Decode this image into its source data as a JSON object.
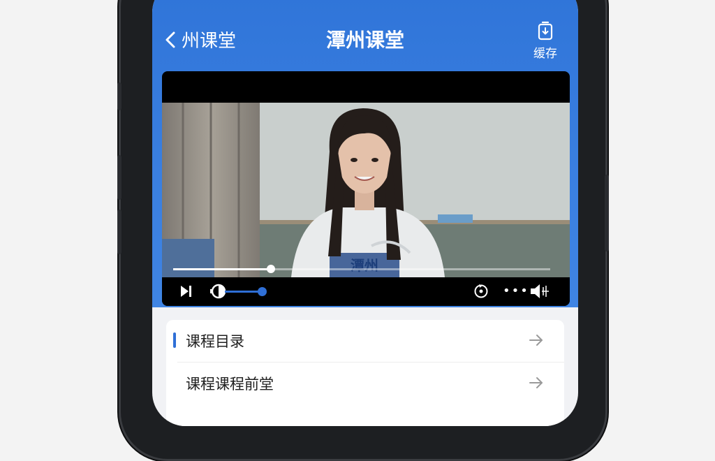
{
  "header": {
    "back_label": "州课堂",
    "title": "潭州课堂",
    "cache_label": "缓存"
  },
  "player": {
    "progress": 0.26,
    "volume": 0.85,
    "shirt_text": "潭州"
  },
  "list": {
    "items": [
      {
        "label": "课程目录"
      },
      {
        "label": "课程课程前堂"
      }
    ]
  },
  "colors": {
    "header_blue": "#3a7fe0",
    "accent_blue": "#2f6fd6"
  }
}
